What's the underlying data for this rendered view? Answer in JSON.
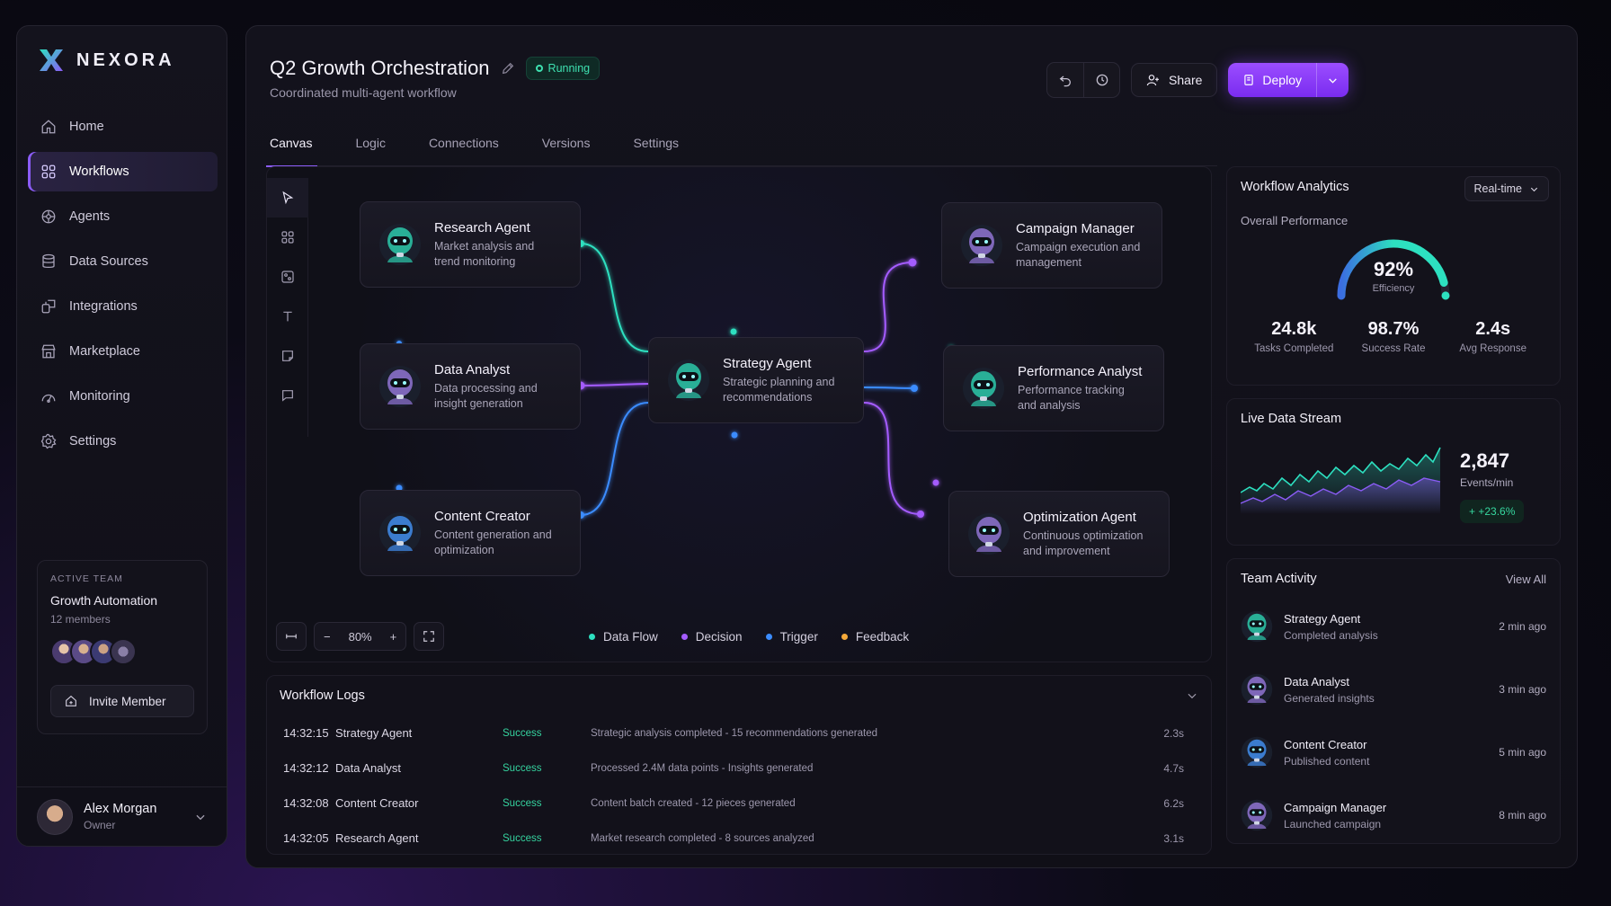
{
  "brand": {
    "name": "NEXORA",
    "accent": "#8b5cf6"
  },
  "sidebar": {
    "items": [
      {
        "label": "Home",
        "icon": "home-icon",
        "active": false
      },
      {
        "label": "Workflows",
        "icon": "grid-icon",
        "active": true
      },
      {
        "label": "Agents",
        "icon": "agents-icon",
        "active": false
      },
      {
        "label": "Data Sources",
        "icon": "database-icon",
        "active": false
      },
      {
        "label": "Integrations",
        "icon": "plug-icon",
        "active": false
      },
      {
        "label": "Marketplace",
        "icon": "store-icon",
        "active": false
      },
      {
        "label": "Monitoring",
        "icon": "monitor-icon",
        "active": false
      },
      {
        "label": "Settings",
        "icon": "gear-icon",
        "active": false
      }
    ],
    "team": {
      "eyebrow": "ACTIVE TEAM",
      "name": "Growth Automation",
      "members": "12 members",
      "invite_label": "Invite Member"
    },
    "user": {
      "name": "Alex Morgan",
      "role": "Owner"
    }
  },
  "header": {
    "title": "Q2 Growth Orchestration",
    "status": "Running",
    "subtitle": "Coordinated multi-agent workflow",
    "share_label": "Share",
    "deploy_label": "Deploy"
  },
  "tabs": [
    {
      "label": "Canvas",
      "active": true
    },
    {
      "label": "Logic",
      "active": false
    },
    {
      "label": "Connections",
      "active": false
    },
    {
      "label": "Versions",
      "active": false
    },
    {
      "label": "Settings",
      "active": false
    }
  ],
  "canvas": {
    "agents": {
      "research": {
        "name": "Research Agent",
        "desc": "Market analysis and trend monitoring"
      },
      "data": {
        "name": "Data Analyst",
        "desc": "Data processing and insight generation"
      },
      "content": {
        "name": "Content Creator",
        "desc": "Content generation and optimization"
      },
      "strategy": {
        "name": "Strategy Agent",
        "desc": "Strategic planning and recommendations"
      },
      "campaign": {
        "name": "Campaign Manager",
        "desc": "Campaign execution and management"
      },
      "performance": {
        "name": "Performance Analyst",
        "desc": "Performance tracking and analysis"
      },
      "optimization": {
        "name": "Optimization Agent",
        "desc": "Continuous optimization and improvement"
      }
    },
    "zoom": "80%",
    "legend": [
      {
        "label": "Data Flow",
        "color": "#2de0c0"
      },
      {
        "label": "Decision",
        "color": "#a45cff"
      },
      {
        "label": "Trigger",
        "color": "#3b8cff"
      },
      {
        "label": "Feedback",
        "color": "#f5a93a"
      }
    ]
  },
  "logs": {
    "title": "Workflow Logs",
    "rows": [
      {
        "time": "14:32:15",
        "agent": "Strategy Agent",
        "status": "Success",
        "message": "Strategic analysis completed - 15 recommendations generated",
        "duration": "2.3s"
      },
      {
        "time": "14:32:12",
        "agent": "Data Analyst",
        "status": "Success",
        "message": "Processed 2.4M data points - Insights generated",
        "duration": "4.7s"
      },
      {
        "time": "14:32:08",
        "agent": "Content Creator",
        "status": "Success",
        "message": "Content batch created - 12 pieces generated",
        "duration": "6.2s"
      },
      {
        "time": "14:32:05",
        "agent": "Research Agent",
        "status": "Success",
        "message": "Market research completed - 8 sources analyzed",
        "duration": "3.1s"
      }
    ]
  },
  "analytics": {
    "title": "Workflow Analytics",
    "range": "Real-time",
    "overall_label": "Overall Performance",
    "efficiency": "92%",
    "efficiency_fraction": 0.92,
    "efficiency_label": "Efficiency",
    "stats": [
      {
        "value": "24.8k",
        "label": "Tasks Completed"
      },
      {
        "value": "98.7%",
        "label": "Success Rate"
      },
      {
        "value": "2.4s",
        "label": "Avg Response"
      }
    ]
  },
  "stream": {
    "title": "Live Data Stream",
    "value": "2,847",
    "unit": "Events/min",
    "delta": "+ +23.6%"
  },
  "activity": {
    "title": "Team Activity",
    "view_all": "View All",
    "items": [
      {
        "name": "Strategy Agent",
        "action": "Completed analysis",
        "time": "2 min ago"
      },
      {
        "name": "Data Analyst",
        "action": "Generated insights",
        "time": "3 min ago"
      },
      {
        "name": "Content Creator",
        "action": "Published content",
        "time": "5 min ago"
      },
      {
        "name": "Campaign Manager",
        "action": "Launched campaign",
        "time": "8 min ago"
      }
    ]
  }
}
